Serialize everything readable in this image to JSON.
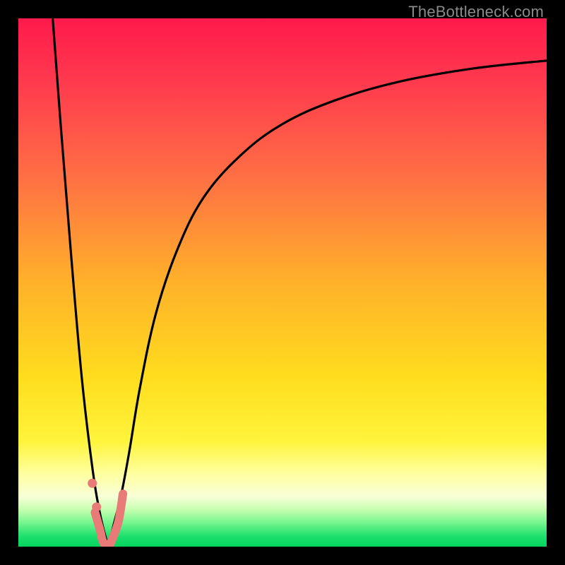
{
  "attribution": "TheBottleneck.com",
  "colors": {
    "frame": "#000000",
    "curve_primary": "#000000",
    "curve_accent": "#e87a78",
    "dot": "#e87a78",
    "gradient_stops": [
      {
        "offset": 0.0,
        "color": "#ff1a4b"
      },
      {
        "offset": 0.12,
        "color": "#ff3a4e"
      },
      {
        "offset": 0.3,
        "color": "#ff6f44"
      },
      {
        "offset": 0.5,
        "color": "#ffb12a"
      },
      {
        "offset": 0.68,
        "color": "#ffdd1e"
      },
      {
        "offset": 0.8,
        "color": "#fff43b"
      },
      {
        "offset": 0.86,
        "color": "#ffff9d"
      },
      {
        "offset": 0.905,
        "color": "#f8ffd7"
      },
      {
        "offset": 0.93,
        "color": "#c6ffb0"
      },
      {
        "offset": 0.955,
        "color": "#74f58e"
      },
      {
        "offset": 0.98,
        "color": "#1fe06e"
      },
      {
        "offset": 1.0,
        "color": "#04d45f"
      }
    ]
  },
  "chart_data": {
    "type": "line",
    "title": "",
    "xlabel": "",
    "ylabel": "",
    "xlim": [
      0,
      100
    ],
    "ylim": [
      0,
      100
    ],
    "grid": false,
    "series": [
      {
        "name": "left-branch",
        "x": [
          6.5,
          8,
          10,
          12,
          14,
          15.5,
          17
        ],
        "values": [
          100,
          80,
          55,
          32,
          15,
          6,
          0
        ]
      },
      {
        "name": "right-branch",
        "x": [
          17,
          18,
          19.5,
          21,
          23,
          26,
          30,
          35,
          42,
          50,
          60,
          72,
          86,
          100
        ],
        "values": [
          0,
          4,
          10,
          18,
          30,
          44,
          56,
          66,
          74,
          80,
          84.5,
          88,
          90.5,
          92
        ]
      }
    ],
    "accent_segment": {
      "name": "valley-accent",
      "x": [
        14.5,
        15.5,
        16.0,
        17.0,
        18.0,
        19.0,
        19.8
      ],
      "values": [
        6.5,
        3.0,
        1.0,
        0.0,
        2.0,
        5.0,
        10.0
      ]
    },
    "dots": [
      {
        "x": 14.0,
        "y": 12.0
      },
      {
        "x": 14.8,
        "y": 7.5
      }
    ]
  }
}
